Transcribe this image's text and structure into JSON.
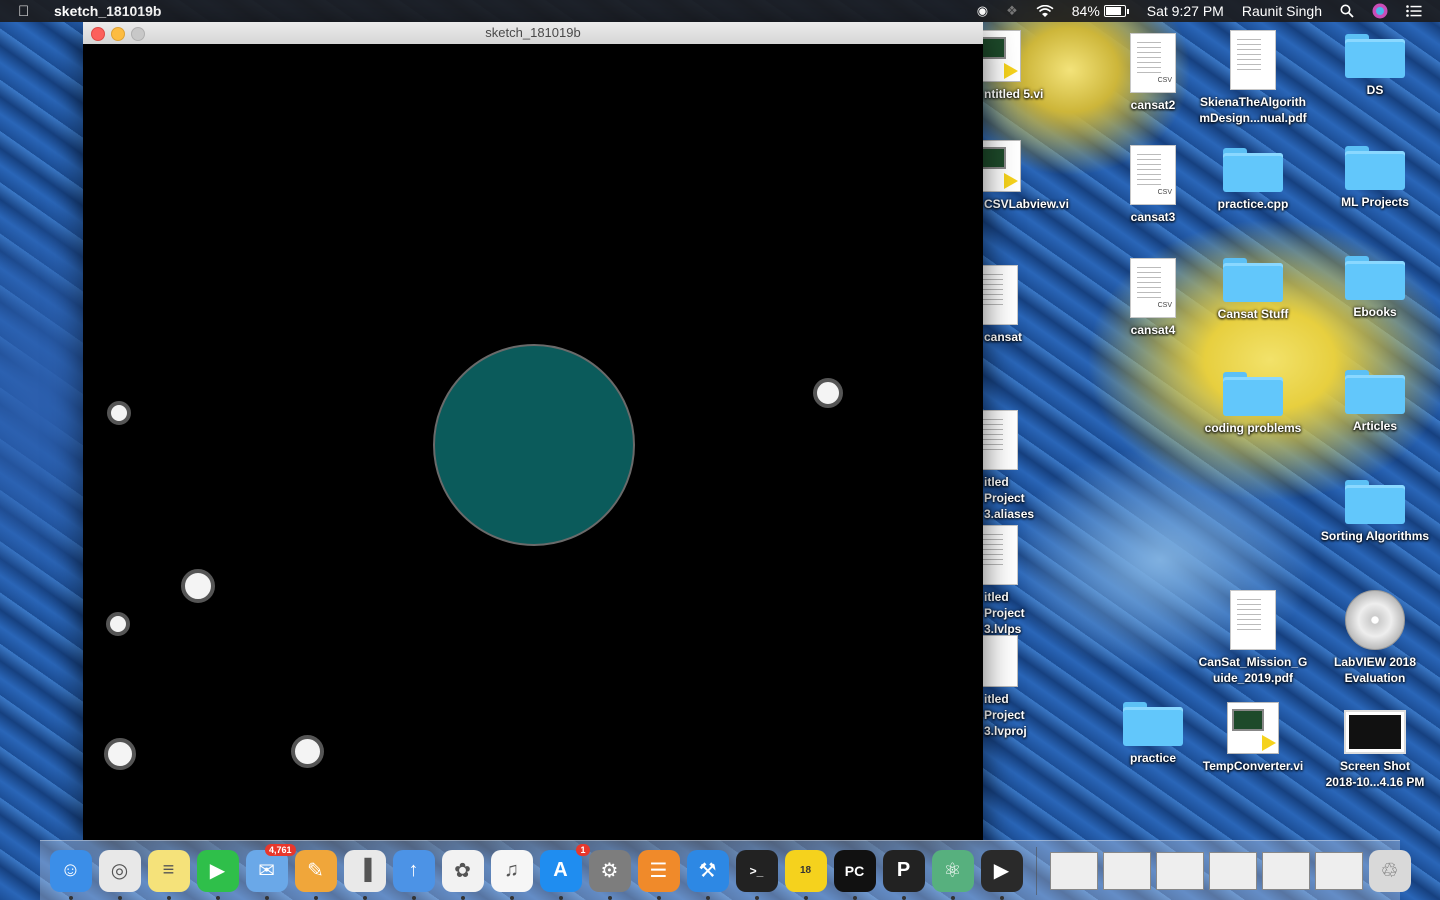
{
  "menubar": {
    "app_name": "sketch_181019b",
    "battery": "84%",
    "clock": "Sat 9:27 PM",
    "user": "Raunit Singh"
  },
  "window": {
    "title": "sketch_181019b"
  },
  "desktop": {
    "col1": [
      {
        "label": "ntitled 5.vi",
        "icon": "labview-vi-icon"
      },
      {
        "label": "CSVLabview.vi",
        "icon": "labview-vi-icon"
      },
      {
        "label": "cansat",
        "icon": "spreadsheet-icon"
      },
      {
        "label": "itled Project\n3.aliases",
        "icon": "document-icon"
      },
      {
        "label": "itled Project\n3.lvlps",
        "icon": "document-icon"
      },
      {
        "label": "itled Project\n3.lvproj",
        "icon": "labview-project-icon"
      }
    ],
    "col2": [
      {
        "label": "cansat2",
        "icon": "csv-icon",
        "tag": "CSV"
      },
      {
        "label": "cansat3",
        "icon": "csv-icon",
        "tag": "CSV"
      },
      {
        "label": "cansat4",
        "icon": "csv-icon",
        "tag": "CSV"
      },
      {
        "label": "practice",
        "icon": "folder-icon"
      }
    ],
    "col3": [
      {
        "label": "SkienaTheAlgorith\nmDesign...nual.pdf",
        "icon": "pdf-icon"
      },
      {
        "label": "practice.cpp",
        "icon": "folder-icon"
      },
      {
        "label": "Cansat Stuff",
        "icon": "folder-icon"
      },
      {
        "label": "coding problems",
        "icon": "folder-icon"
      },
      {
        "label": "CanSat_Mission_G\nuide_2019.pdf",
        "icon": "pdf-icon"
      },
      {
        "label": "TempConverter.vi",
        "icon": "labview-vi-icon"
      }
    ],
    "col4": [
      {
        "label": "DS",
        "icon": "folder-icon"
      },
      {
        "label": "ML Projects",
        "icon": "folder-icon"
      },
      {
        "label": "Ebooks",
        "icon": "folder-icon"
      },
      {
        "label": "Articles",
        "icon": "folder-icon"
      },
      {
        "label": "Sorting Algorithms",
        "icon": "folder-icon"
      },
      {
        "label": "LabVIEW 2018\nEvaluation",
        "icon": "labview-disc-icon"
      },
      {
        "label": "Screen Shot\n2018-10...4.16 PM",
        "icon": "screenshot-icon"
      }
    ]
  },
  "dock": {
    "apps": [
      {
        "name": "finder-icon",
        "color": "#3b8ee8"
      },
      {
        "name": "chrome-icon",
        "color": "#e8e8e8"
      },
      {
        "name": "notes-icon",
        "color": "#f5e27a"
      },
      {
        "name": "facetime-icon",
        "color": "#2fbf4a"
      },
      {
        "name": "mail-icon",
        "color": "#6aa8e8",
        "badge": "4,761"
      },
      {
        "name": "pages-icon",
        "color": "#f0a63a"
      },
      {
        "name": "numbers-icon",
        "color": "#e9e9e9"
      },
      {
        "name": "keynote-icon",
        "color": "#4c93e6"
      },
      {
        "name": "photos-icon",
        "color": "#f2f2f2"
      },
      {
        "name": "itunes-icon",
        "color": "#f6f6f6"
      },
      {
        "name": "app-store-icon",
        "color": "#1f8df0",
        "badge": "1"
      },
      {
        "name": "system-preferences-icon",
        "color": "#7d7d7d"
      },
      {
        "name": "ibooks-icon",
        "color": "#f08a2a"
      },
      {
        "name": "xcode-icon",
        "color": "#2d88e4"
      },
      {
        "name": "terminal-icon",
        "color": "#222222"
      },
      {
        "name": "labview-icon",
        "color": "#f5d21d"
      },
      {
        "name": "pycharm-icon",
        "color": "#111111"
      },
      {
        "name": "processing-icon",
        "color": "#222222"
      },
      {
        "name": "atom-icon",
        "color": "#57b07e"
      },
      {
        "name": "quicktime-icon",
        "color": "#2a2a2a"
      }
    ],
    "labview_badge": "18",
    "pycharm_label": "PC",
    "terminal_label": ">_"
  },
  "sketch": {
    "planet_color": "#0b5b5b"
  }
}
